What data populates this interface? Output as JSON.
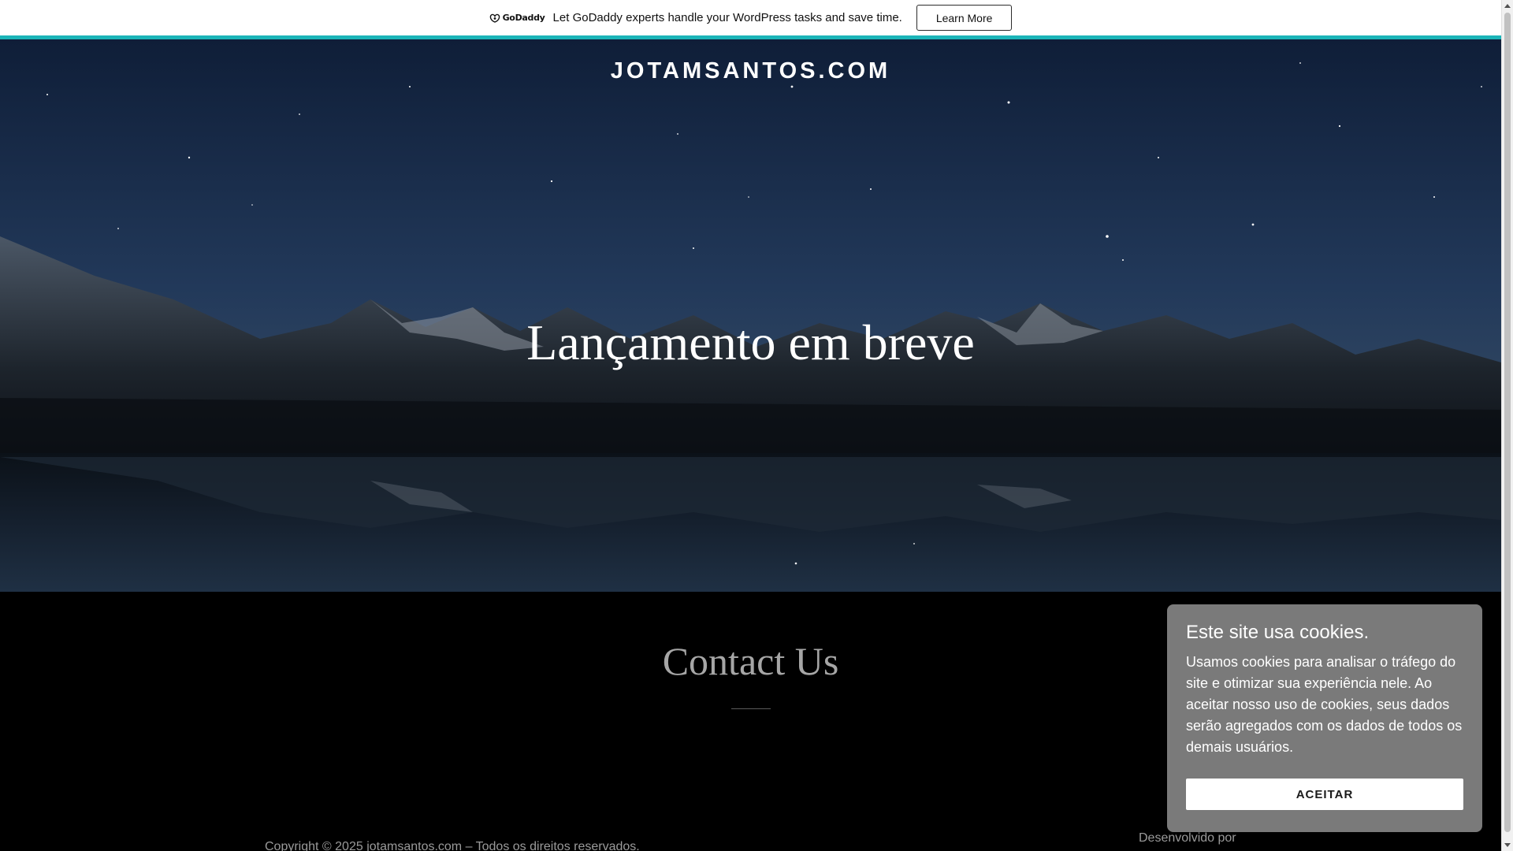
{
  "promo": {
    "logo_text": "GoDaddy",
    "message": "Let GoDaddy experts handle your WordPress tasks and save time.",
    "button_label": "Learn More",
    "accent_color": "#1bb4b8"
  },
  "site": {
    "title": "JOTAMSANTOS.COM"
  },
  "hero": {
    "heading": "Lançamento em breve"
  },
  "contact": {
    "title": "Contact Us"
  },
  "footer": {
    "copyright": "Copyright © 2025 jotamsantos.com – Todos os direitos reservados.",
    "powered_by": "Desenvolvido por"
  },
  "cookie": {
    "title": "Este site usa cookies.",
    "body": "Usamos cookies para analisar o tráfego do site e otimizar sua experiência nele. Ao aceitar nosso uso de cookies, seus dados serão agregados com os dados de todos os demais usuários.",
    "accept_label": "ACEITAR"
  }
}
